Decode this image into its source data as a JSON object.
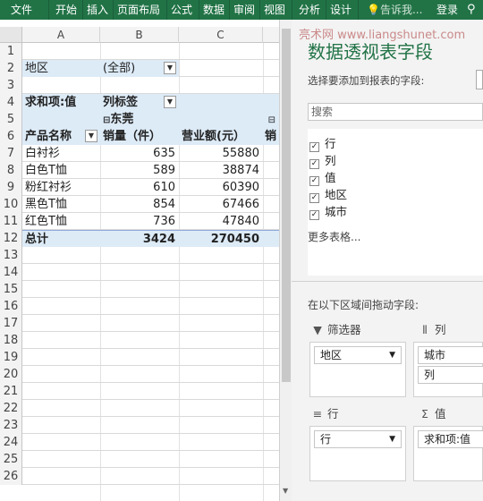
{
  "ribbon": {
    "tabs": [
      "文件",
      "开始",
      "插入",
      "页面布局",
      "公式",
      "数据",
      "审阅",
      "视图",
      "分析",
      "设计"
    ],
    "tell_me": "告诉我...",
    "login": "登录"
  },
  "colors": {
    "accent": "#217346",
    "pivot_header": "#ddebf7"
  },
  "sheet": {
    "col_headers": [
      "A",
      "B",
      "C"
    ],
    "row_numbers": [
      "1",
      "2",
      "3",
      "4",
      "5",
      "6",
      "7",
      "8",
      "9",
      "10",
      "11",
      "12",
      "13",
      "14",
      "15",
      "16",
      "17",
      "18",
      "19",
      "20",
      "21",
      "22",
      "23",
      "24",
      "25",
      "26"
    ],
    "filter_label": "地区",
    "filter_value": "(全部)",
    "value_label": "求和项:值",
    "col_labels": "列标签",
    "city_group": "东莞",
    "product_header": "产品名称",
    "sales_header": "销量（件）",
    "revenue_header": "营业额(元）",
    "extra_header": "销",
    "rows": [
      {
        "name": "白衬衫",
        "qty": "635",
        "rev": "55880"
      },
      {
        "name": "白色T恤",
        "qty": "589",
        "rev": "38874"
      },
      {
        "name": "粉红衬衫",
        "qty": "610",
        "rev": "60390"
      },
      {
        "name": "黑色T恤",
        "qty": "854",
        "rev": "67466"
      },
      {
        "name": "红色T恤",
        "qty": "736",
        "rev": "47840"
      }
    ],
    "total_label": "总计",
    "total_qty": "3424",
    "total_rev": "270450"
  },
  "pane": {
    "title": "数据透视表字段",
    "watermark": "亮术网 www.liangshunet.com",
    "subtitle": "选择要添加到报表的字段:",
    "search_placeholder": "搜索",
    "fields": [
      {
        "label": "行",
        "checked": true
      },
      {
        "label": "列",
        "checked": true
      },
      {
        "label": "值",
        "checked": true
      },
      {
        "label": "地区",
        "checked": true
      },
      {
        "label": "城市",
        "checked": true
      }
    ],
    "more_tables": "更多表格...",
    "drag_label": "在以下区域间拖动字段:",
    "zones": {
      "filters": {
        "title": "筛选器",
        "items": [
          "地区"
        ]
      },
      "columns": {
        "title": "列",
        "items": [
          "城市",
          "列"
        ]
      },
      "rows": {
        "title": "行",
        "items": [
          "行"
        ]
      },
      "values": {
        "title": "值",
        "items": [
          "求和项:值"
        ]
      }
    }
  }
}
